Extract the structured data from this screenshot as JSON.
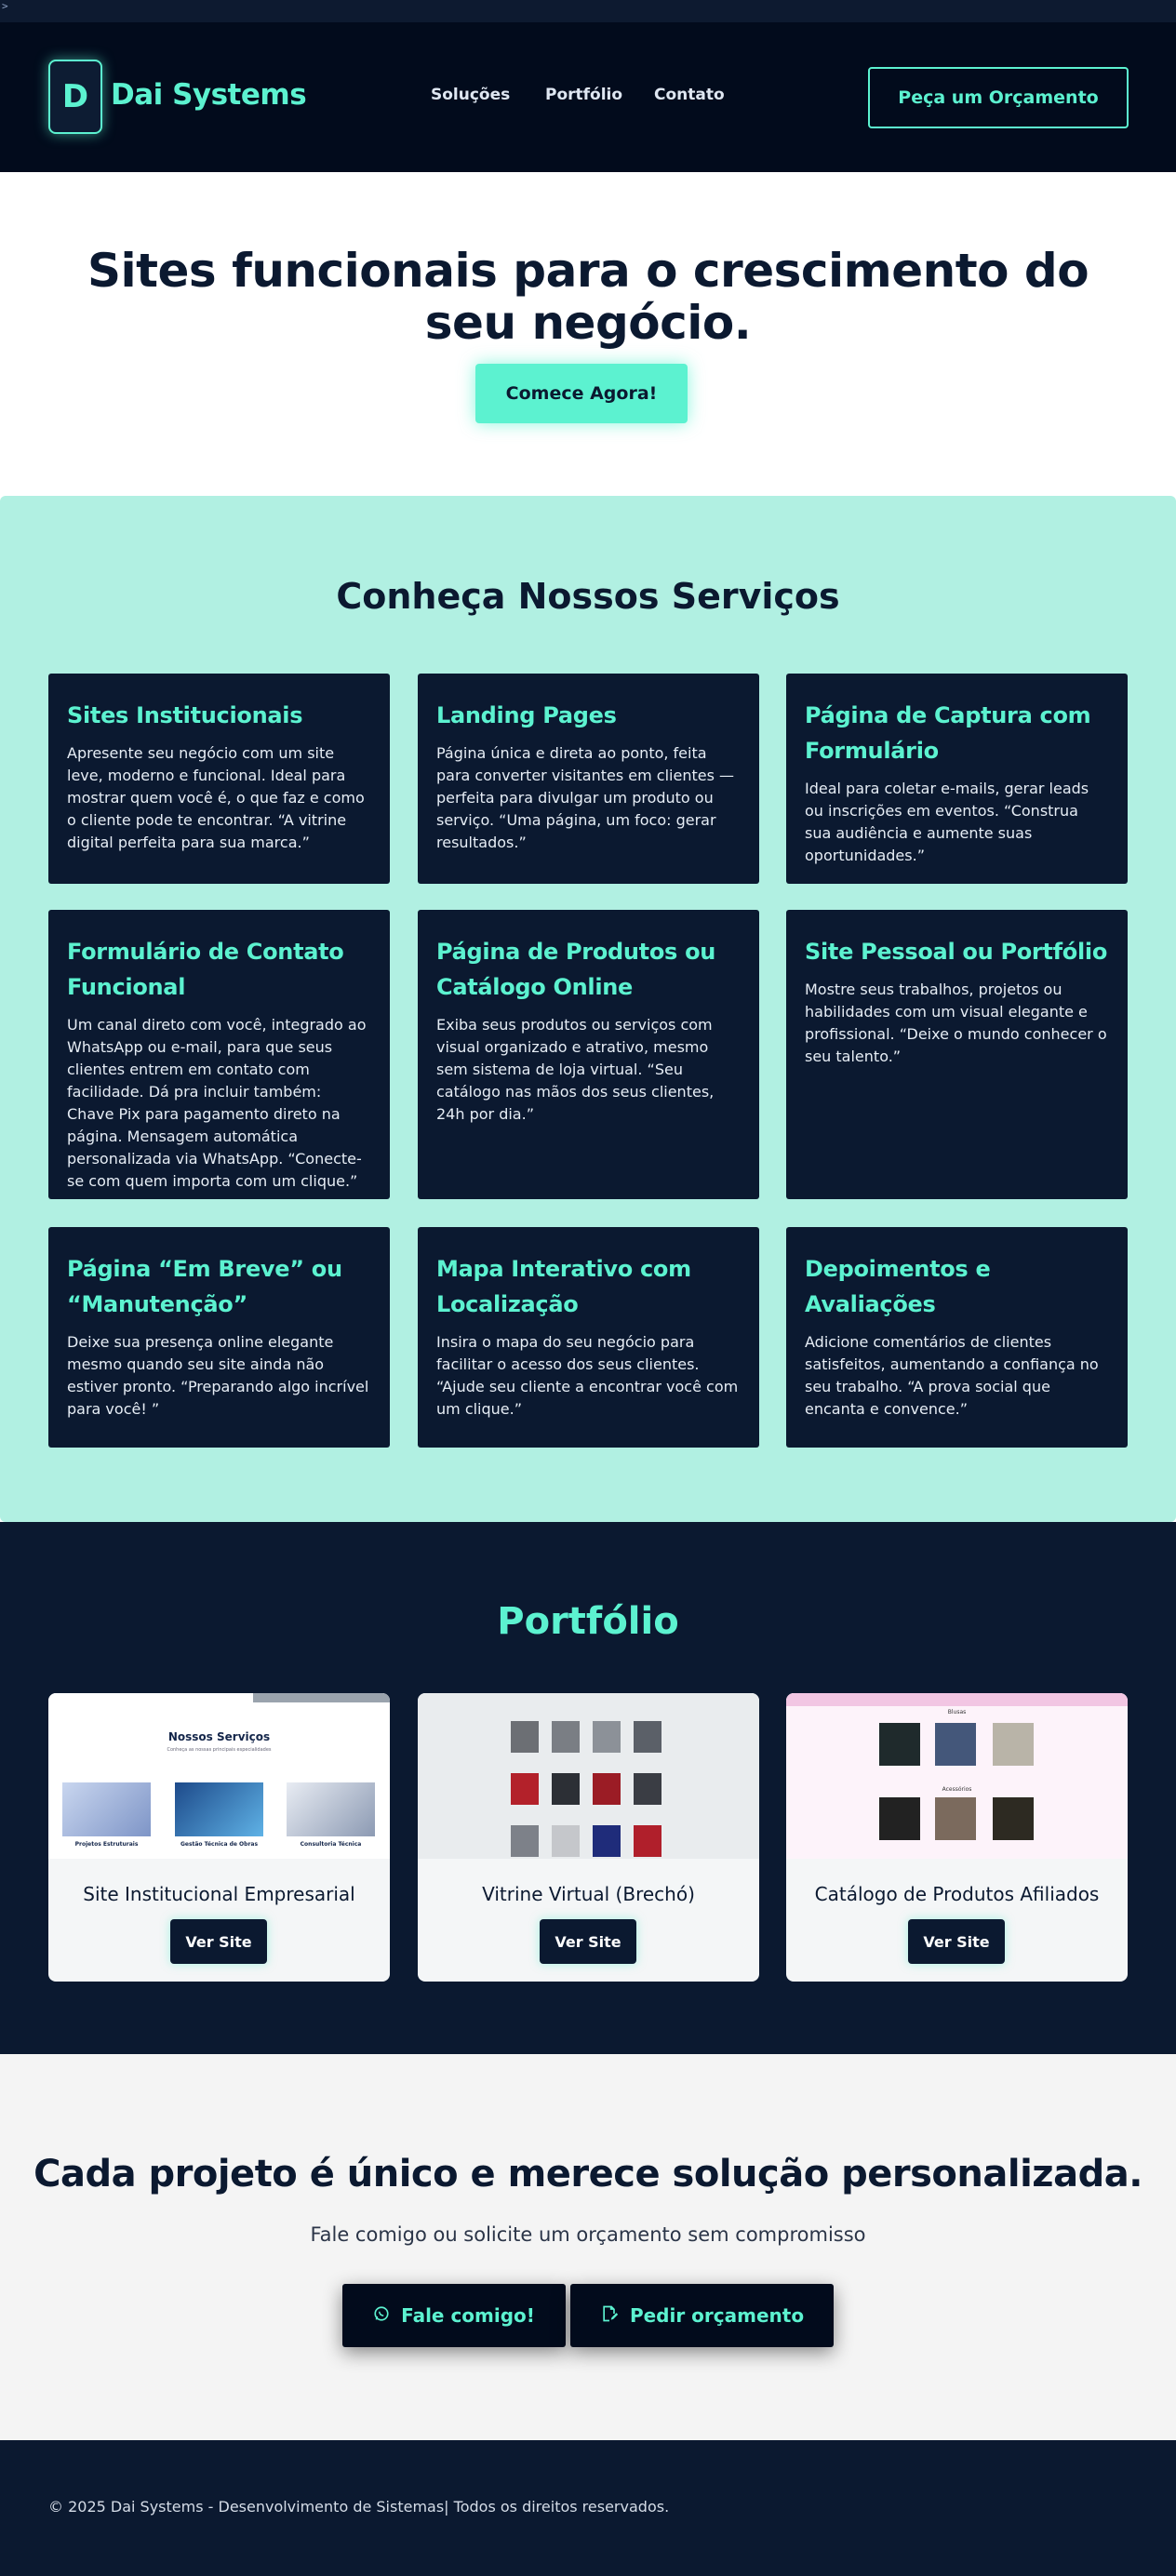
{
  "header": {
    "logo_letter": "D",
    "brand": "Dai Systems",
    "nav": [
      "Soluções",
      "Portfólio",
      "Contato"
    ],
    "cta": "Peça um Orçamento"
  },
  "hero": {
    "title": "Sites funcionais para o crescimento do seu negócio.",
    "button": "Comece Agora!"
  },
  "services": {
    "title": "Conheça Nossos Serviços",
    "cards": [
      {
        "title": "Sites Institucionais",
        "text": "Apresente seu negócio com um site leve, moderno e funcional. Ideal para mostrar quem você é, o que faz e como o cliente pode te encontrar. “A vitrine digital perfeita para sua marca.”"
      },
      {
        "title": "Landing Pages",
        "text": "Página única e direta ao ponto, feita para converter visitantes em clientes — perfeita para divulgar um produto ou serviço. “Uma página, um foco: gerar resultados.”"
      },
      {
        "title": "Página de Captura com Formulário",
        "text": "Ideal para coletar e-mails, gerar leads ou inscrições em eventos. “Construa sua audiência e aumente suas oportunidades.”"
      },
      {
        "title": "Formulário de Contato Funcional",
        "text": "Um canal direto com você, integrado ao WhatsApp ou e-mail, para que seus clientes entrem em contato com facilidade. Dá pra incluir também: Chave Pix para pagamento direto na página. Mensagem automática personalizada via WhatsApp. “Conecte-se com quem importa com um clique.”"
      },
      {
        "title": "Página de Produtos ou Catálogo Online",
        "text": "Exiba seus produtos ou serviços com visual organizado e atrativo, mesmo sem sistema de loja virtual. “Seu catálogo nas mãos dos seus clientes, 24h por dia.”"
      },
      {
        "title": "Site Pessoal ou Portfólio",
        "text": "Mostre seus trabalhos, projetos ou habilidades com um visual elegante e profissional. “Deixe o mundo conhecer o seu talento.”"
      },
      {
        "title": "Página “Em Breve” ou “Manutenção”",
        "text": "Deixe sua presença online elegante mesmo quando seu site ainda não estiver pronto. “Preparando algo incrível para você! ”"
      },
      {
        "title": "Mapa Interativo com Localização",
        "text": "Insira o mapa do seu negócio para facilitar o acesso dos seus clientes. “Ajude seu cliente a encontrar você com um clique.”"
      },
      {
        "title": "Depoimentos e Avaliações",
        "text": "Adicione comentários de clientes satisfeitos, aumentando a confiança no seu trabalho. “A prova social que encanta e convence.”"
      }
    ]
  },
  "portfolio": {
    "title": "Portfólio",
    "items": [
      {
        "title": "Site Institucional Empresarial",
        "button": "Ver Site",
        "thumb": {
          "heading": "Nossos Serviços",
          "sub": "Conheça as nossas principais especialidades",
          "labels": [
            "Projetos Estruturais",
            "Gestão Técnica de Obras",
            "Consultoria Técnica"
          ]
        }
      },
      {
        "title": "Vitrine Virtual (Brechó)",
        "button": "Ver Site"
      },
      {
        "title": "Catálogo de Produtos Afiliados",
        "button": "Ver Site",
        "thumb": {
          "heading": "Blusas",
          "heading2": "Acessórios"
        }
      }
    ]
  },
  "cta": {
    "title": "Cada projeto é único e merece solução personalizada.",
    "subtitle": "Fale comigo ou solicite um orçamento sem compromisso",
    "buttons": [
      {
        "label": "Fale comigo!",
        "icon": "whatsapp-icon"
      },
      {
        "label": "Pedir orçamento",
        "icon": "edit-document-icon"
      }
    ]
  },
  "footer": {
    "text": "© 2025 Dai Systems - Desenvolvimento de Sistemas| Todos os direitos reservados."
  },
  "colors": {
    "accent": "#5cf2d0",
    "navy": "#0b1930",
    "dark": "#020b1c",
    "mint_bg": "#b1f0e2"
  }
}
